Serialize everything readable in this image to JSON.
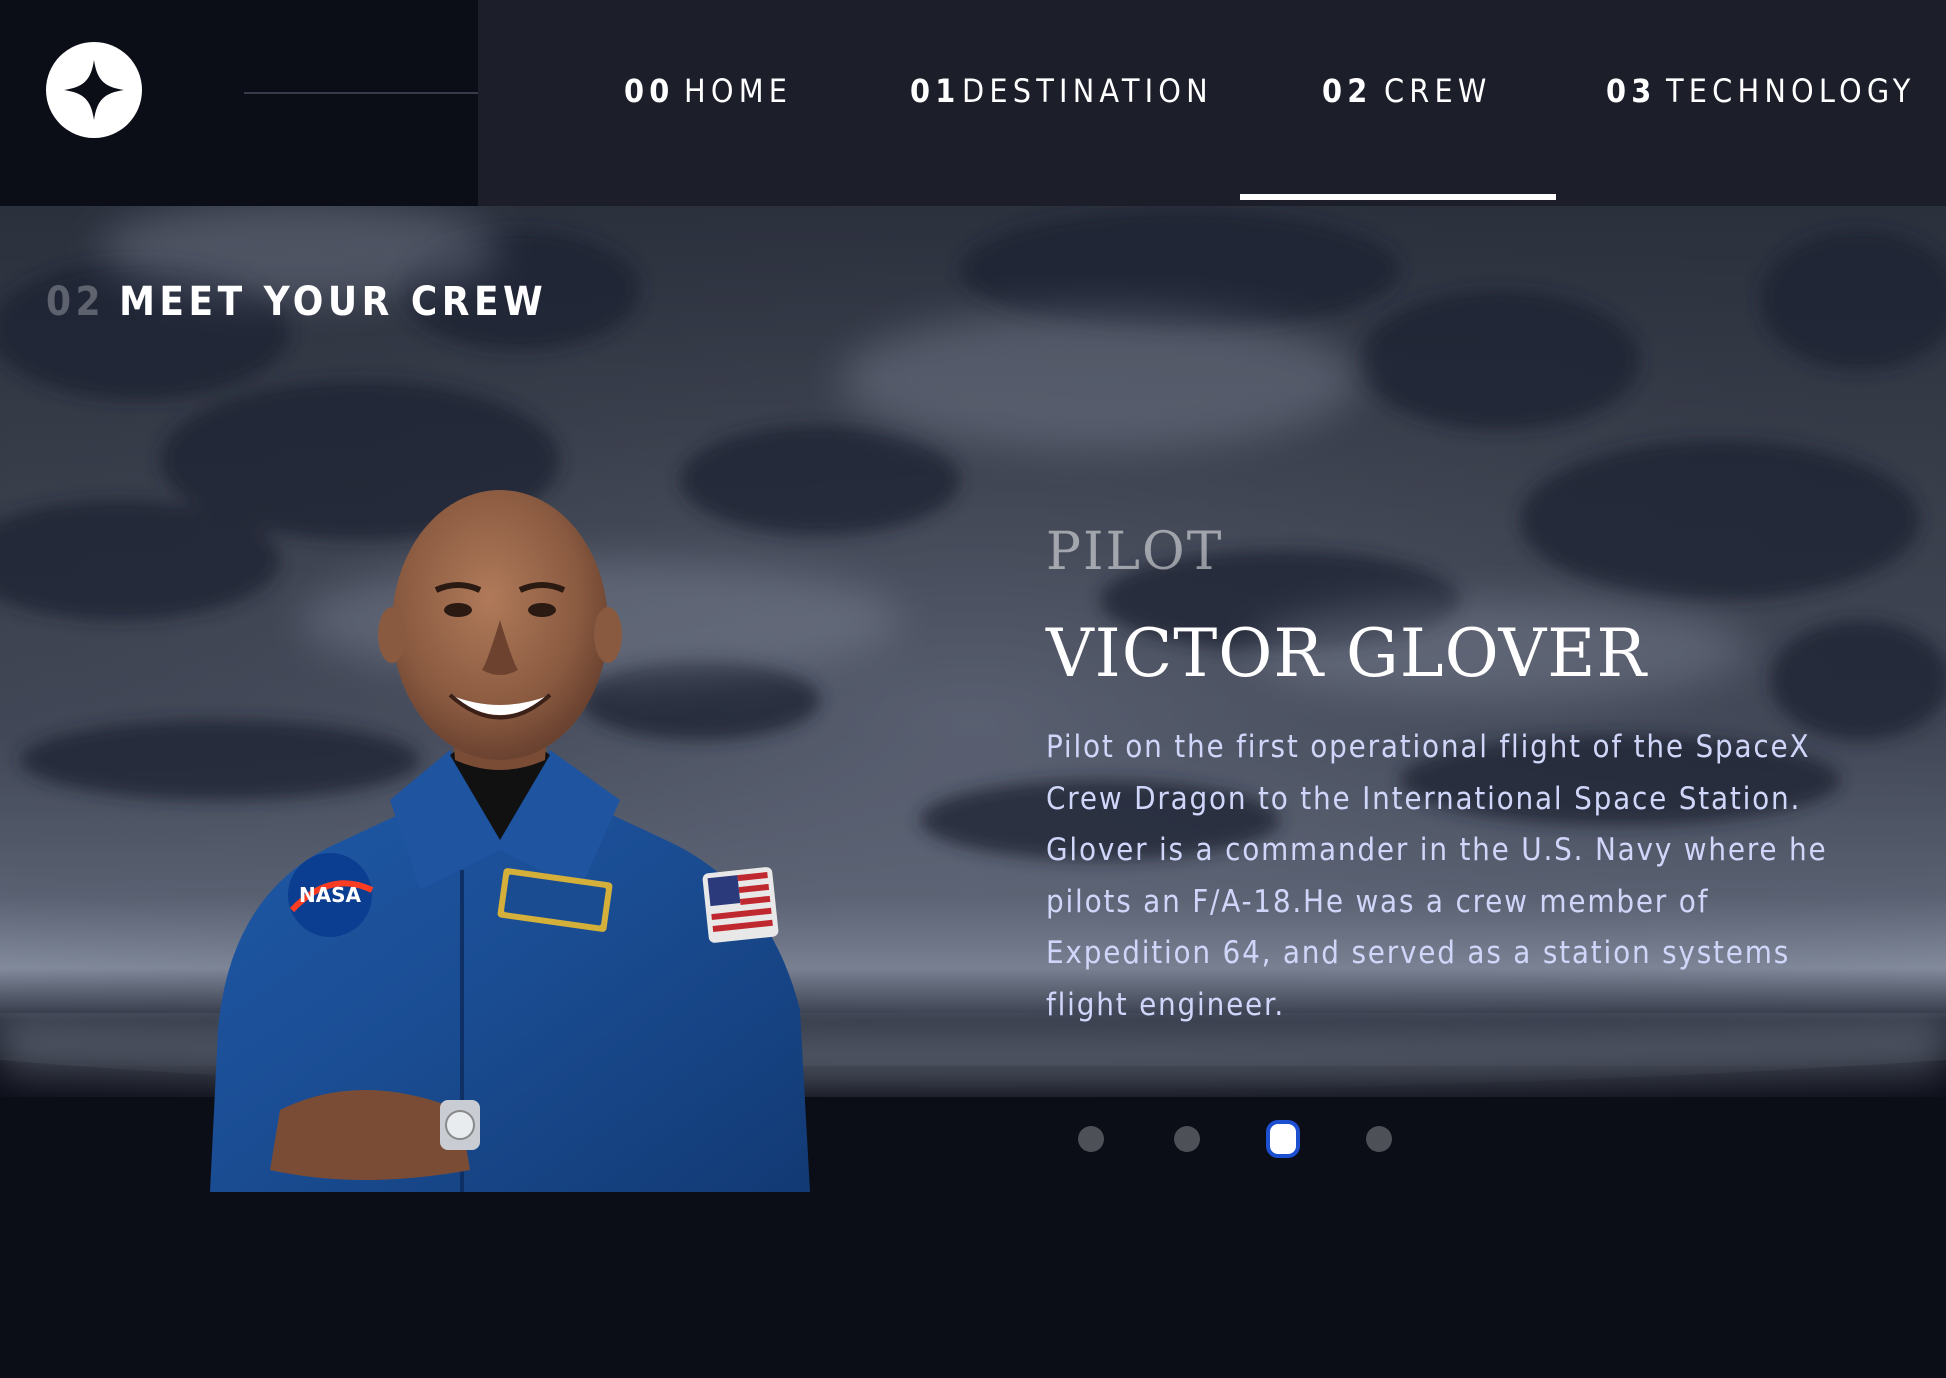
{
  "nav": {
    "items": [
      {
        "num": "00",
        "label": "HOME"
      },
      {
        "num": "01",
        "label": "DESTINATION"
      },
      {
        "num": "02",
        "label": "CREW"
      },
      {
        "num": "03",
        "label": "TECHNOLOGY"
      }
    ],
    "active": "CREW"
  },
  "page": {
    "heading_num": "02",
    "heading_text": "MEET YOUR CREW"
  },
  "crew": {
    "role": "PILOT",
    "name": "VICTOR GLOVER",
    "bio_lines": [
      "Pilot on the first operational flight of the SpaceX",
      "Crew Dragon to the International Space Station.",
      "Glover is a commander in the U.S. Navy where he",
      "pilots an F/A-18.He was a crew member of",
      "Expedition 64, and served as a station systems",
      "flight engineer."
    ]
  },
  "slider": {
    "count": 4,
    "active_index": 2
  },
  "colors": {
    "background": "#0b0d17",
    "nav_background": "#1c1f2a",
    "text_light": "#d0d6f9",
    "focus_ring": "#1d4fd1"
  }
}
